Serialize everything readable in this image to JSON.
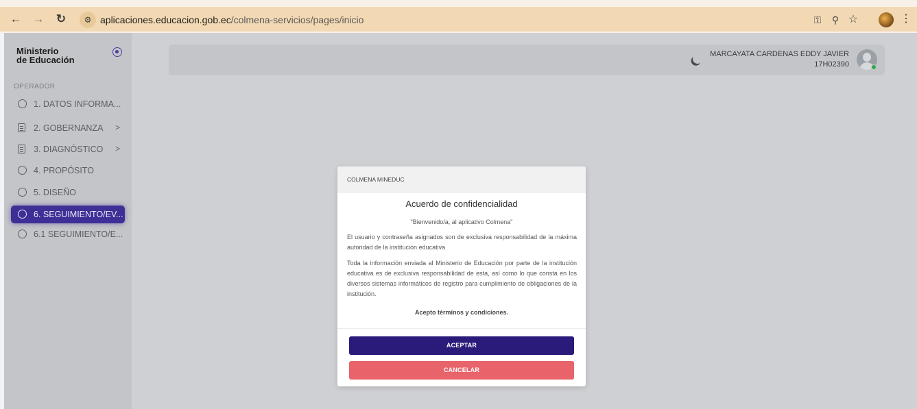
{
  "browser": {
    "url_domain": "aplicaciones.educacion.gob.ec",
    "url_path": "/colmena-servicios/pages/inicio",
    "icons": [
      "back-arrow-icon",
      "forward-arrow-icon",
      "reload-icon",
      "site-info-icon",
      "password-key-icon",
      "zoom-icon",
      "star-icon",
      "profile-avatar",
      "menu-kebab-icon"
    ]
  },
  "sidebar": {
    "brand_line1": "Ministerio",
    "brand_line2": "de Educación",
    "section_label": "OPERADOR",
    "items": [
      {
        "label": "1. DATOS INFORMA...",
        "icon": "circle-icon",
        "chevron": ""
      },
      {
        "label": "2. GOBERNANZA",
        "icon": "document-icon",
        "chevron": ">"
      },
      {
        "label": "3. DIAGNÓSTICO",
        "icon": "document-icon",
        "chevron": ">"
      },
      {
        "label": "4. PROPÓSITO",
        "icon": "circle-icon",
        "chevron": ""
      },
      {
        "label": "5. DISEÑO",
        "icon": "circle-icon",
        "chevron": ""
      },
      {
        "label": "6. SEGUIMIENTO/EV...",
        "icon": "circle-icon",
        "chevron": "",
        "active": true
      },
      {
        "label": "6.1 SEGUIMIENTO/E...",
        "icon": "circle-icon",
        "chevron": ""
      }
    ]
  },
  "header": {
    "user_name": "MARCAYATA CARDENAS EDDY JAVIER",
    "user_code": "17H02390"
  },
  "modal": {
    "header": "COLMENA MINEDUC",
    "title": "Acuerdo de confidencialidad",
    "subtitle": "\"Bienvenido/a, al aplicativo Colmena\"",
    "paragraph1": "El usuario y contraseña asignados son de exclusiva responsabilidad de la máxima autoridad de la institución educativa",
    "paragraph2": "Toda la información enviada al Ministerio de Educación por parte de la institución educativa es de exclusiva responsabilidad de esta, así como lo que consta en los diversos sistemas informáticos de registro para cumplimiento de obligaciones de la institución.",
    "accept_text": "Acepto términos y condiciones.",
    "accept_button": "ACEPTAR",
    "cancel_button": "CANCELAR"
  },
  "colors": {
    "accent": "#2a1a7a",
    "active_item": "#3d2f95",
    "cancel": "#e8636a",
    "browser_bar": "#f2d9b3"
  }
}
